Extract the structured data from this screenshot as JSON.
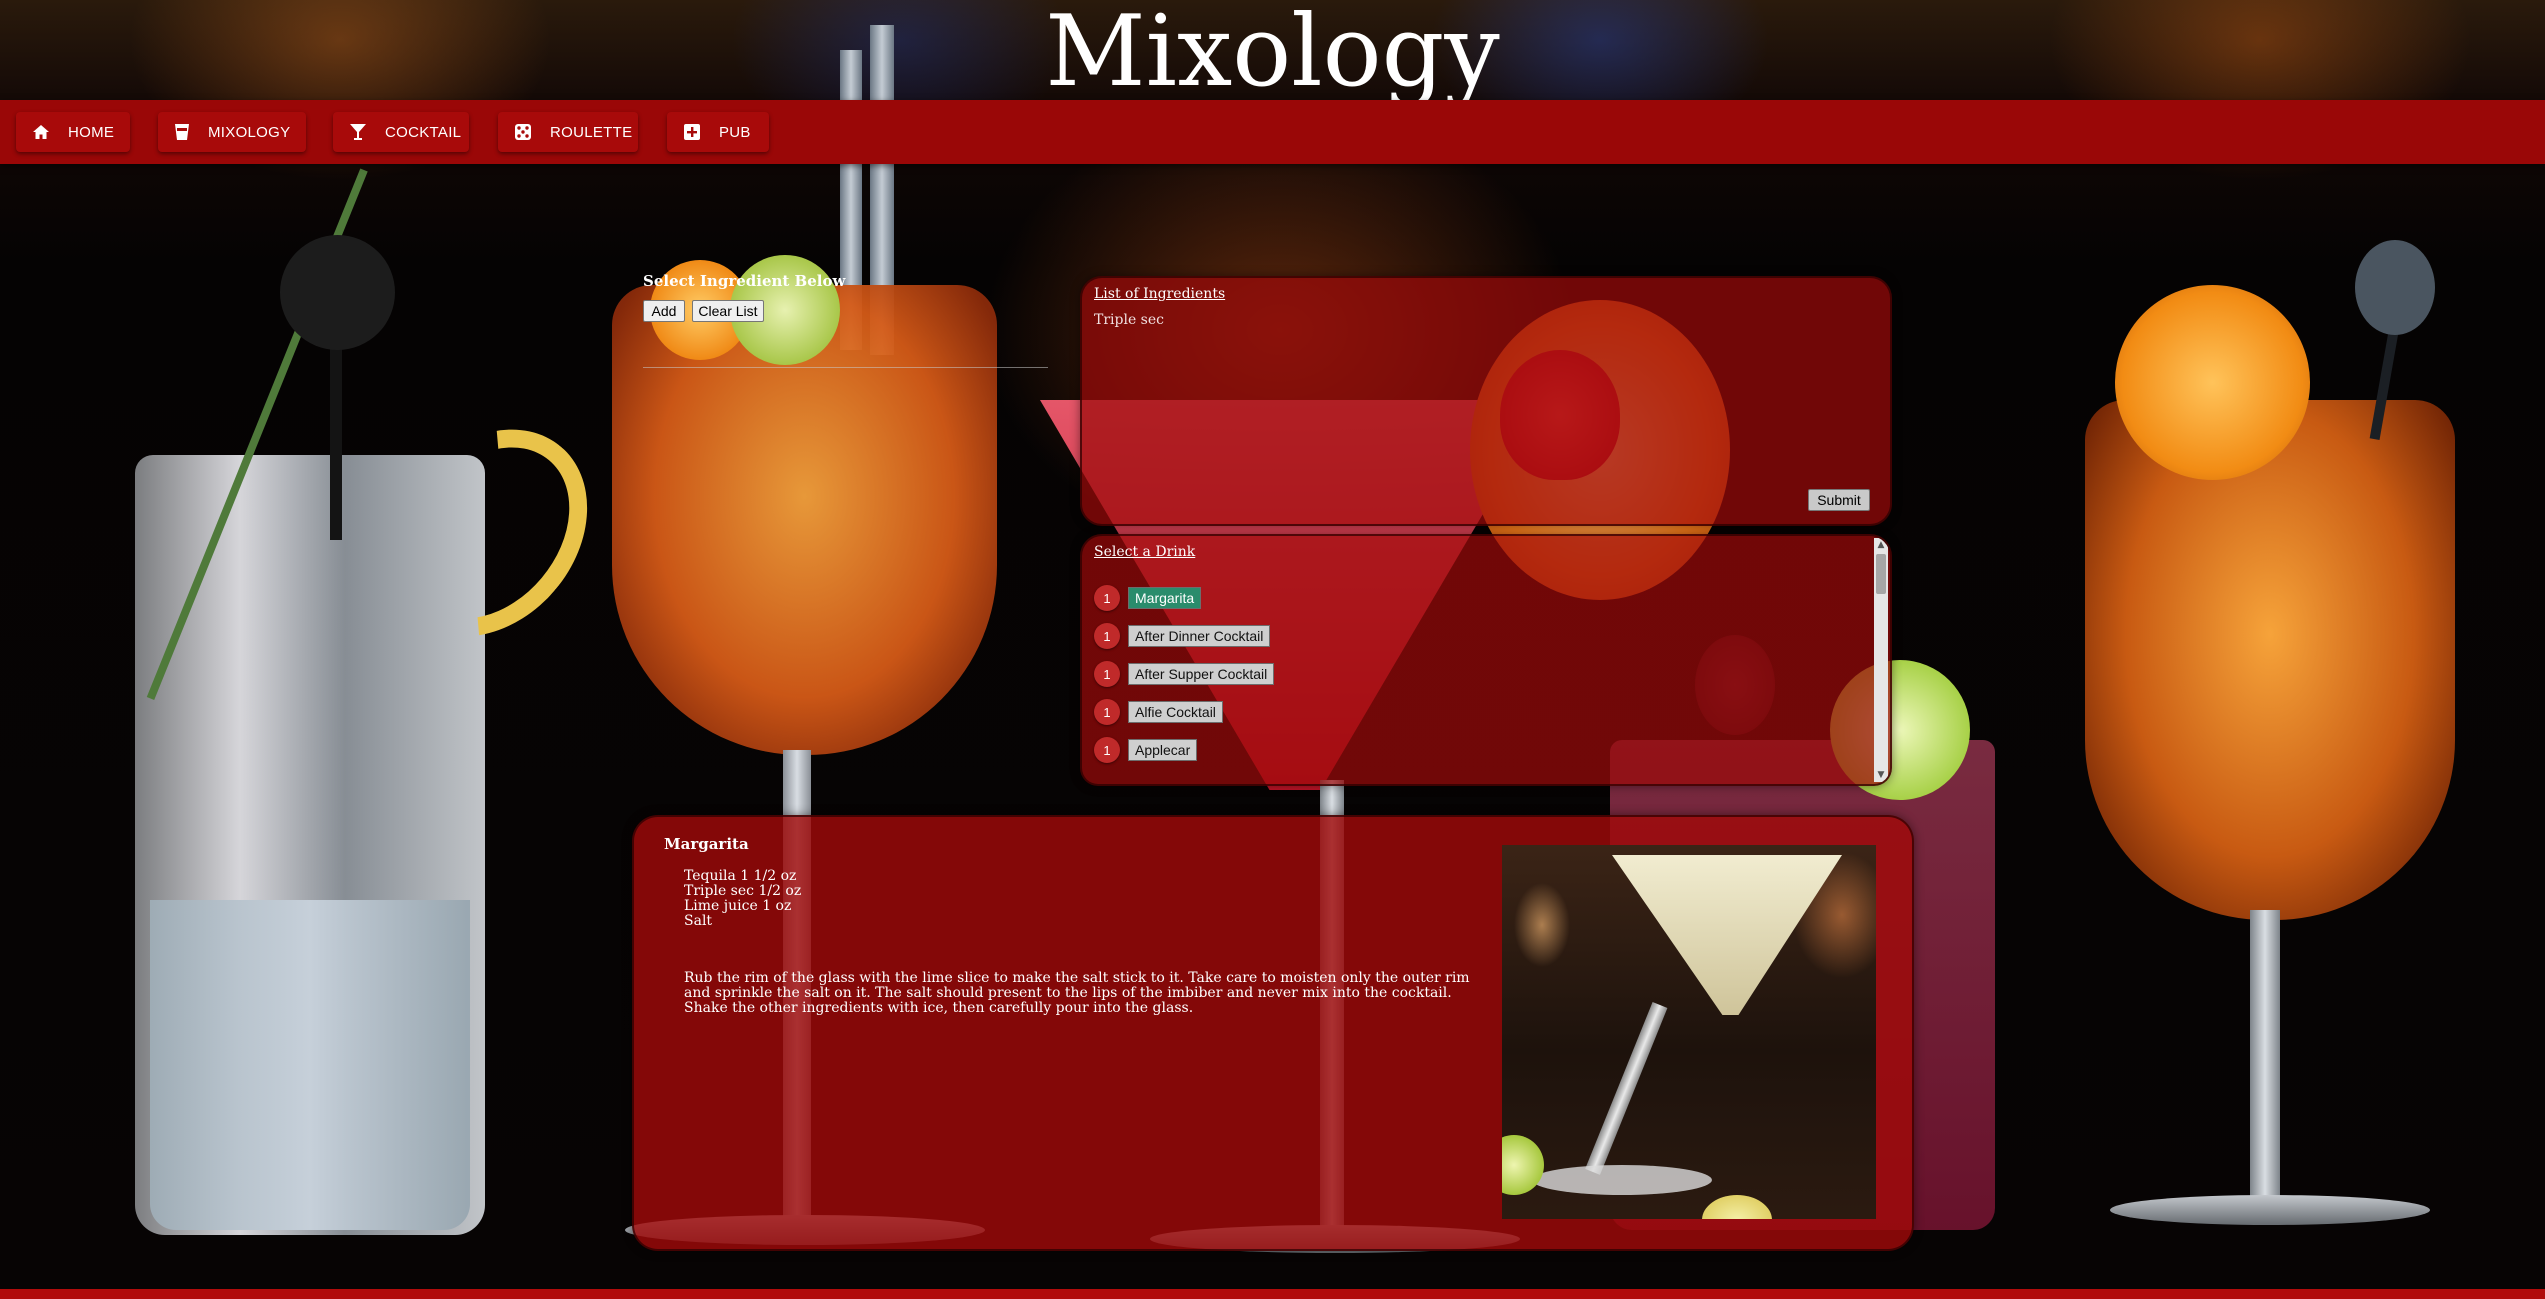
{
  "header": {
    "title": "Mixology"
  },
  "nav": {
    "items": [
      {
        "label": "HOME",
        "icon": "home-icon"
      },
      {
        "label": "MIXOLOGY",
        "icon": "glass-icon"
      },
      {
        "label": "COCKTAIL",
        "icon": "cocktail-icon"
      },
      {
        "label": "ROULETTE",
        "icon": "dice-icon"
      },
      {
        "label": "PUB",
        "icon": "plus-square-icon"
      }
    ]
  },
  "ingredient_select": {
    "label": "Select Ingredient Below",
    "add_label": "Add",
    "clear_label": "Clear List"
  },
  "ingredients_panel": {
    "heading": "List of Ingredients",
    "items": [
      "Triple sec"
    ],
    "submit_label": "Submit"
  },
  "drinks_panel": {
    "heading": "Select a Drink",
    "drinks": [
      {
        "count": "1",
        "name": "Margarita",
        "selected": true
      },
      {
        "count": "1",
        "name": "After Dinner Cocktail",
        "selected": false
      },
      {
        "count": "1",
        "name": "After Supper Cocktail",
        "selected": false
      },
      {
        "count": "1",
        "name": "Alfie Cocktail",
        "selected": false
      },
      {
        "count": "1",
        "name": "Applecar",
        "selected": false
      }
    ]
  },
  "recipe": {
    "title": "Margarita",
    "ingredients": [
      "Tequila 1 1/2 oz",
      "Triple sec 1/2 oz",
      "Lime juice 1 oz",
      "Salt"
    ],
    "instructions": "Rub the rim of the glass with the lime slice to make the salt stick to it. Take care to moisten only the outer rim and sprinkle the salt on it. The salt should present to the lips of the imbiber and never mix into the cocktail. Shake the other ingredients with ice, then carefully pour into the glass."
  },
  "colors": {
    "nav_bar": "#9a0707",
    "panel": "#9b0a0a",
    "selected_drink": "#2a8c6c",
    "badge": "#c02a2a"
  }
}
